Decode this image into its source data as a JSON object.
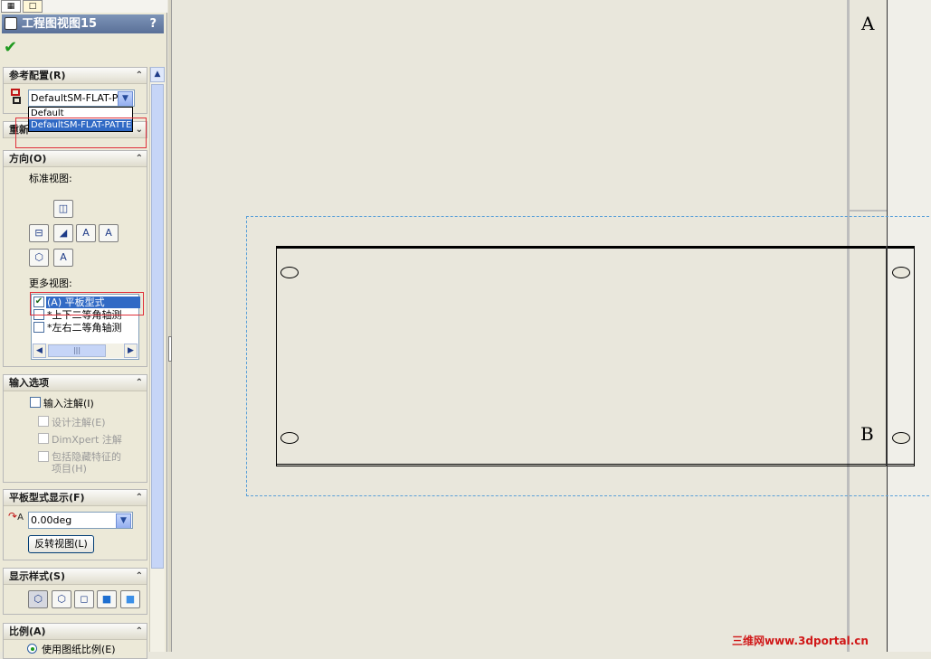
{
  "tabs": [
    {
      "icon": "property-tree-icon"
    },
    {
      "icon": "document-icon"
    }
  ],
  "panel": {
    "title": "工程图视图15",
    "help": "?",
    "ok_icon": "checkmark-icon",
    "ref_config": {
      "header": "参考配置(R)",
      "selected": "DefaultSM-FLAT-PA",
      "options": [
        "Default",
        "DefaultSM-FLAT-PATTE"
      ]
    },
    "reuse_header": "重新",
    "orientation": {
      "header": "方向(O)",
      "std_views_label": "标准视图:",
      "more_views_label": "更多视图:",
      "list": [
        {
          "label": "(A) 平板型式",
          "checked": true
        },
        {
          "label": "*上下二等角轴测",
          "checked": false
        },
        {
          "label": "*左右二等角轴测",
          "checked": false
        }
      ],
      "scroll_thumb": "|||"
    },
    "import": {
      "header": "输入选项",
      "import_annotations": "输入注解(I)",
      "design_annotations": "设计注解(E)",
      "dimxpert": "DimXpert 注解",
      "hidden_items_l1": "包括隐藏特征的",
      "hidden_items_l2": "项目(H)"
    },
    "flat": {
      "header": "平板型式显示(F)",
      "angle": "0.00deg",
      "flip_button": "反转视图(L)"
    },
    "display": {
      "header": "显示样式(S)"
    },
    "scale": {
      "header": "比例(A)",
      "use_sheet": "使用图纸比例(E)"
    }
  },
  "canvas": {
    "zone_a": "A",
    "zone_b": "B",
    "watermark": "三维网www.3dportal.cn"
  }
}
